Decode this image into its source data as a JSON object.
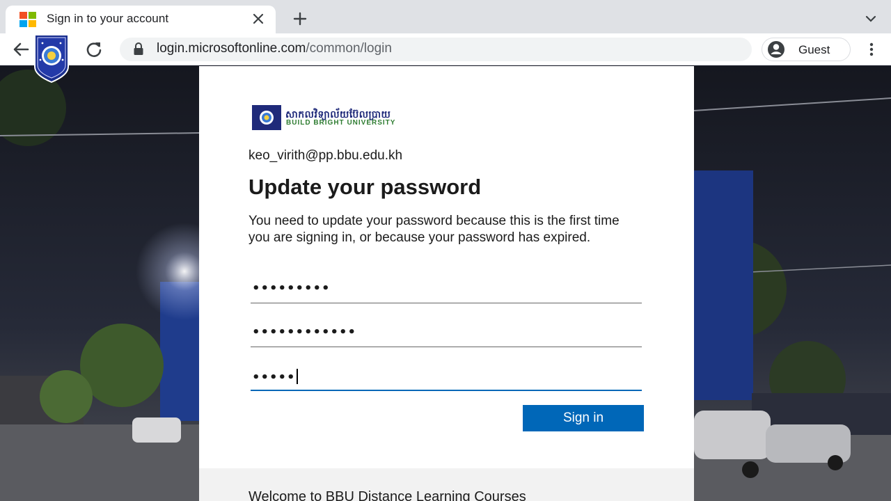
{
  "browser": {
    "tab_title": "Sign in to your account",
    "url_host": "login.microsoftonline.com",
    "url_path": "/common/login",
    "profile_label": "Guest",
    "favicon_colors": [
      "#f25022",
      "#7fba00",
      "#00a4ef",
      "#ffb900"
    ]
  },
  "signin": {
    "brand_khmer": "សាកលវិទ្យាល័យប៊ែលប្រាយ",
    "brand_latin": "BUILD BRIGHT UNIVERSITY",
    "identity": "keo_virith@pp.bbu.edu.kh",
    "title": "Update your password",
    "description": "You need to update your password because this is the first time you are signing in, or because your password has expired.",
    "fields": {
      "current_password": "•••••••••",
      "new_password": "••••••••••••",
      "confirm_password": "•••••"
    },
    "submit_label": "Sign in",
    "footer_text": "Welcome to BBU Distance Learning Courses",
    "accent_color": "#0067b8"
  }
}
